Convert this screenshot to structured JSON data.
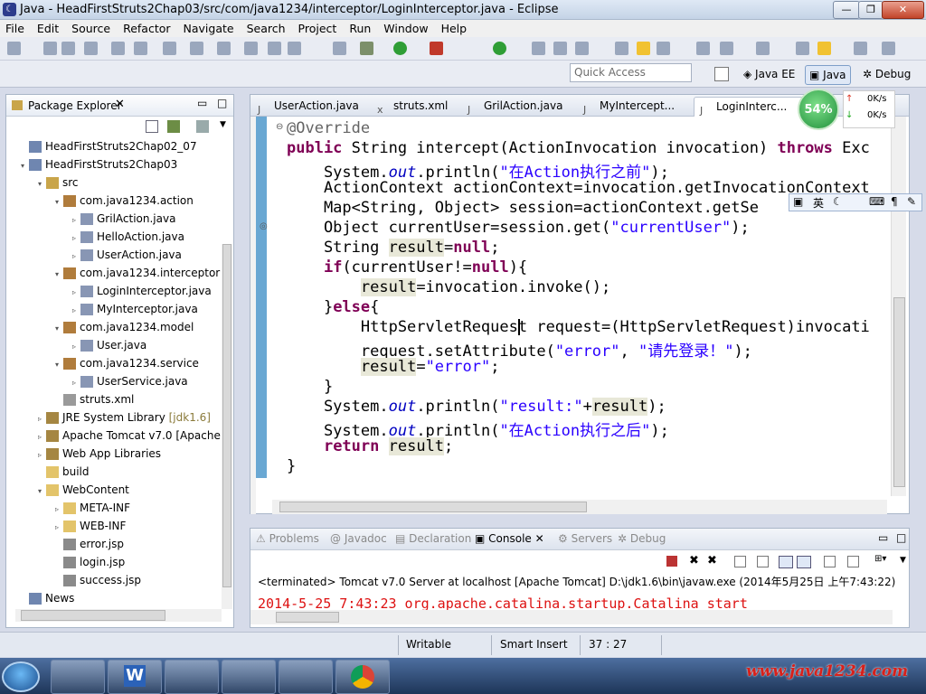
{
  "window": {
    "title": "Java - HeadFirstStruts2Chap03/src/com/java1234/interceptor/LoginInterceptor.java - Eclipse"
  },
  "menu": [
    "File",
    "Edit",
    "Source",
    "Refactor",
    "Navigate",
    "Search",
    "Project",
    "Run",
    "Window",
    "Help"
  ],
  "quick_access": {
    "placeholder": "Quick Access"
  },
  "perspectives": [
    "Java EE",
    "Java",
    "Debug"
  ],
  "package_explorer": {
    "title": "Package Explorer",
    "items": [
      {
        "label": "HeadFirstStruts2Chap02_07",
        "depth": 0,
        "icon": "project-icon",
        "twisty": ""
      },
      {
        "label": "HeadFirstStruts2Chap03",
        "depth": 0,
        "icon": "project-icon",
        "twisty": "▾"
      },
      {
        "label": "src",
        "depth": 1,
        "icon": "source-folder-icon",
        "twisty": "▾"
      },
      {
        "label": "com.java1234.action",
        "depth": 2,
        "icon": "package-icon",
        "twisty": "▾"
      },
      {
        "label": "GrilAction.java",
        "depth": 3,
        "icon": "java-file-icon",
        "twisty": "▹"
      },
      {
        "label": "HelloAction.java",
        "depth": 3,
        "icon": "java-file-icon",
        "twisty": "▹"
      },
      {
        "label": "UserAction.java",
        "depth": 3,
        "icon": "java-file-icon",
        "twisty": "▹"
      },
      {
        "label": "com.java1234.interceptor",
        "depth": 2,
        "icon": "package-icon",
        "twisty": "▾"
      },
      {
        "label": "LoginInterceptor.java",
        "depth": 3,
        "icon": "java-file-icon",
        "twisty": "▹"
      },
      {
        "label": "MyInterceptor.java",
        "depth": 3,
        "icon": "java-file-icon",
        "twisty": "▹"
      },
      {
        "label": "com.java1234.model",
        "depth": 2,
        "icon": "package-icon",
        "twisty": "▾"
      },
      {
        "label": "User.java",
        "depth": 3,
        "icon": "java-file-icon",
        "twisty": "▹"
      },
      {
        "label": "com.java1234.service",
        "depth": 2,
        "icon": "package-icon",
        "twisty": "▾"
      },
      {
        "label": "UserService.java",
        "depth": 3,
        "icon": "java-file-icon",
        "twisty": "▹"
      },
      {
        "label": "struts.xml",
        "depth": 2,
        "icon": "xml-file-icon",
        "twisty": ""
      },
      {
        "label": "JRE System Library",
        "depth": 1,
        "icon": "library-icon",
        "twisty": "▹",
        "suffix": "[jdk1.6]"
      },
      {
        "label": "Apache Tomcat v7.0 [Apache",
        "depth": 1,
        "icon": "library-icon",
        "twisty": "▹"
      },
      {
        "label": "Web App Libraries",
        "depth": 1,
        "icon": "library-icon",
        "twisty": "▹"
      },
      {
        "label": "build",
        "depth": 1,
        "icon": "folder-icon",
        "twisty": ""
      },
      {
        "label": "WebContent",
        "depth": 1,
        "icon": "folder-icon",
        "twisty": "▾"
      },
      {
        "label": "META-INF",
        "depth": 2,
        "icon": "folder-icon",
        "twisty": "▹"
      },
      {
        "label": "WEB-INF",
        "depth": 2,
        "icon": "folder-icon",
        "twisty": "▹"
      },
      {
        "label": "error.jsp",
        "depth": 2,
        "icon": "jsp-file-icon",
        "twisty": ""
      },
      {
        "label": "login.jsp",
        "depth": 2,
        "icon": "jsp-file-icon",
        "twisty": ""
      },
      {
        "label": "success.jsp",
        "depth": 2,
        "icon": "jsp-file-icon",
        "twisty": ""
      },
      {
        "label": "News",
        "depth": 0,
        "icon": "project-icon",
        "twisty": ""
      }
    ]
  },
  "editor": {
    "tabs": [
      "UserAction.java",
      "struts.xml",
      "GrilAction.java",
      "MyIntercept...",
      "LoginInterc..."
    ],
    "code": [
      "@Override",
      "public String intercept(ActionInvocation invocation) throws Exc",
      "    System.out.println(\"在Action执行之前\");",
      "    ActionContext actionContext=invocation.getInvocationContext",
      "    Map<String, Object> session=actionContext.getSe",
      "    Object currentUser=session.get(\"currentUser\");",
      "    String result=null;",
      "    if(currentUser!=null){",
      "        result=invocation.invoke();",
      "    }else{",
      "        HttpServletRequest request=(HttpServletRequest)invocati",
      "        request.setAttribute(\"error\", \"请先登录！\");",
      "        result=\"error\";",
      "    }",
      "    System.out.println(\"result:\"+result);",
      "    System.out.println(\"在Action执行之后\");",
      "    return result;",
      "}"
    ]
  },
  "console": {
    "tabs": [
      "Problems",
      "Javadoc",
      "Declaration",
      "Console",
      "Servers",
      "Debug"
    ],
    "active_tab": "Console",
    "terminated": "<terminated> Tomcat v7.0 Server at localhost [Apache Tomcat] D:\\jdk1.6\\bin\\javaw.exe (2014年5月25日 上午7:43:22)",
    "log_line": "2014-5-25 7:43:23 org.apache.catalina.startup.Catalina start"
  },
  "statusbar": {
    "writable": "Writable",
    "insert": "Smart Insert",
    "position": "37 : 27"
  },
  "net_widget": {
    "percent": "54%",
    "up": "0K/s",
    "down": "0K/s"
  },
  "ime": {
    "label": "英"
  },
  "watermark": "www.java1234.com",
  "colors": {
    "keyword": "#7f0055",
    "string": "#2a00ff",
    "field": "#0000c0",
    "annotation": "#646464"
  }
}
